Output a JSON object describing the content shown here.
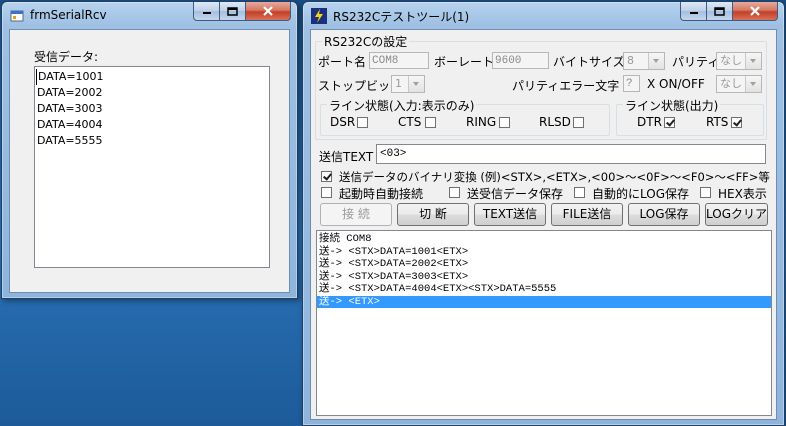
{
  "left_window": {
    "title": "frmSerialRcv",
    "received_label": "受信データ:",
    "received_lines": [
      "DATA=1001",
      "DATA=2002",
      "DATA=3003",
      "DATA=4004",
      "DATA=5555"
    ]
  },
  "right_window": {
    "title": "RS232Cテストツール(1)",
    "settings_group": "RS232Cの設定",
    "port_label": "ポート名",
    "port_value": "COM8",
    "baud_label": "ボーレート",
    "baud_value": "9600",
    "bytesize_label": "バイトサイズ",
    "bytesize_value": "8",
    "parity_label": "パリティ",
    "parity_value": "なし",
    "stopbit_label": "ストップビット",
    "stopbit_value": "1",
    "parity_error_label": "パリティエラー文字",
    "parity_error_value": "?",
    "xonoff_label": "X ON/OFF",
    "xonoff_value": "なし",
    "line_in_group": "ライン状態(入力:表示のみ)",
    "dsr_label": "DSR",
    "cts_label": "CTS",
    "ring_label": "RING",
    "rlsd_label": "RLSD",
    "line_out_group": "ライン状態(出力)",
    "dtr_label": "DTR",
    "rts_label": "RTS",
    "send_text_label": "送信TEXT",
    "send_text_value": "<03>",
    "binary_option": "送信データのバイナリ変換 (例)<STX>,<ETX>,<00>〜<0F>〜<F0>〜<FF>等",
    "auto_connect_label": "起動時自動接続",
    "save_data_label": "送受信データ保存",
    "auto_log_label": "自動的にLOG保存",
    "hex_label": "HEX表示",
    "buttons": {
      "connect": "接 続",
      "disconnect": "切 断",
      "send_text": "TEXT送信",
      "send_file": "FILE送信",
      "log_save": "LOG保存",
      "log_clear": "LOGクリア"
    },
    "log_lines": [
      "接続 COM8",
      "送-> <STX>DATA=1001<ETX>",
      "送-> <STX>DATA=2002<ETX>",
      "送-> <STX>DATA=3003<ETX>",
      "送-> <STX>DATA=4004<ETX><STX>DATA=5555",
      "送-> <ETX>"
    ]
  },
  "checkbox_states": {
    "dsr": false,
    "cts": false,
    "ring": false,
    "rlsd": false,
    "dtr": true,
    "rts": true,
    "binary": true,
    "auto_connect": false,
    "save_data": false,
    "auto_log": false,
    "hex": false
  },
  "colors": {
    "selection": "#3399ff",
    "close_button": "#c24026",
    "desktop": "#2a74b8"
  }
}
